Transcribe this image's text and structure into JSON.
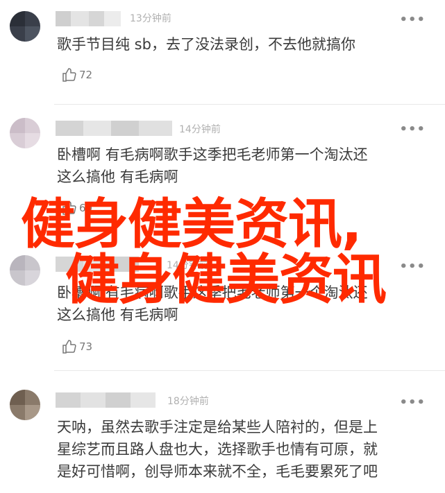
{
  "comments": [
    {
      "time": "13分钟前",
      "text": "歌手节目纯 sb，去了没法录创，不去他就搞你",
      "likes": "72"
    },
    {
      "time": "14分钟前",
      "text": "卧槽啊 有毛病啊歌手这季把毛老师第一个淘汰还\n这么搞他 有毛病啊",
      "likes": "60"
    },
    {
      "time": "14分钟前",
      "text": "卧槽啊 有毛病啊歌手这季把毛老师第一个淘汰还\n这么搞他 有毛病啊",
      "likes": "73"
    },
    {
      "time": "18分钟前",
      "text": "天呐，虽然去歌手注定是给某些人陪衬的，但是上\n星综艺而且路人盘也大，选择歌手也情有可原，就\n是好可惜啊，创导师本来就不全，毛毛要累死了吧"
    }
  ],
  "more_glyph": "•••",
  "overlay": {
    "line1": "健身健美资讯,",
    "line2": "健身健美资讯",
    "color": "#ff2a00"
  },
  "icons": [
    "thumbs-up-icon",
    "more-icon"
  ]
}
